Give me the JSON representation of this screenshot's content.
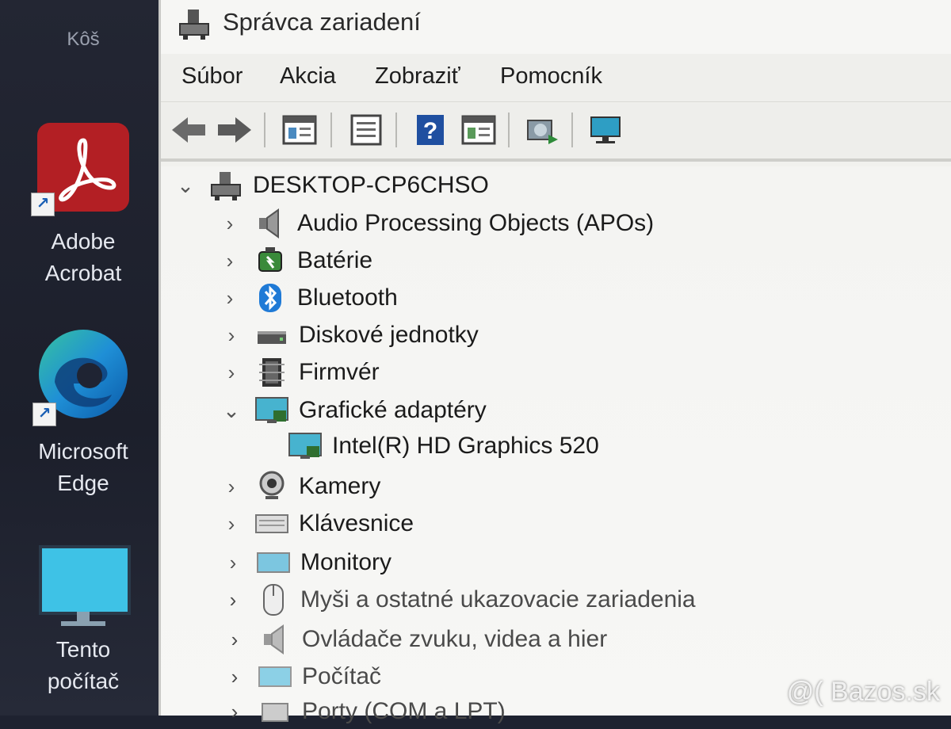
{
  "desktop": {
    "items": [
      {
        "label": "Kôš",
        "icon": "recycle-bin-icon"
      },
      {
        "label": "Adobe Acrobat",
        "line1": "Adobe",
        "line2": "Acrobat",
        "icon": "adobe-acrobat-icon"
      },
      {
        "label": "Microsoft Edge",
        "line1": "Microsoft",
        "line2": "Edge",
        "icon": "microsoft-edge-icon"
      },
      {
        "label": "Tento počítač",
        "line1": "Tento",
        "line2": "počítač",
        "icon": "monitor-icon"
      }
    ]
  },
  "window": {
    "title": "Správca zariadení",
    "menu": [
      "Súbor",
      "Akcia",
      "Zobraziť",
      "Pomocník"
    ],
    "toolbar": [
      "back-arrow-icon",
      "forward-arrow-icon",
      "properties-icon",
      "update-driver-list-icon",
      "help-icon",
      "show-hidden-icon",
      "scan-hardware-icon",
      "monitor-device-icon"
    ]
  },
  "tree": {
    "root": {
      "label": "DESKTOP-CP6CHSO",
      "expanded": true,
      "icon": "computer-icon"
    },
    "categories": [
      {
        "label": "Audio Processing Objects (APOs)",
        "icon": "speaker-icon",
        "expanded": false
      },
      {
        "label": "Batérie",
        "icon": "battery-icon",
        "expanded": false
      },
      {
        "label": "Bluetooth",
        "icon": "bluetooth-icon",
        "expanded": false
      },
      {
        "label": "Diskové jednotky",
        "icon": "disk-drive-icon",
        "expanded": false
      },
      {
        "label": "Firmvér",
        "icon": "firmware-chip-icon",
        "expanded": false
      },
      {
        "label": "Grafické adaptéry",
        "icon": "display-adapter-icon",
        "expanded": true,
        "children": [
          {
            "label": "Intel(R) HD Graphics 520",
            "icon": "display-adapter-icon"
          }
        ]
      },
      {
        "label": "Kamery",
        "icon": "camera-icon",
        "expanded": false
      },
      {
        "label": "Klávesnice",
        "icon": "keyboard-icon",
        "expanded": false
      },
      {
        "label": "Monitory",
        "icon": "monitor-icon",
        "expanded": false
      },
      {
        "label": "Myši a ostatné ukazovacie zariadenia",
        "icon": "mouse-icon",
        "expanded": false
      },
      {
        "label": "Ovládače zvuku, videa a hier",
        "icon": "sound-icon",
        "expanded": false
      },
      {
        "label": "Počítač",
        "icon": "computer-icon",
        "expanded": false
      },
      {
        "label": "Porty (COM a LPT)",
        "icon": "port-icon",
        "expanded": false
      }
    ]
  },
  "watermark": "@( Bazos.sk"
}
